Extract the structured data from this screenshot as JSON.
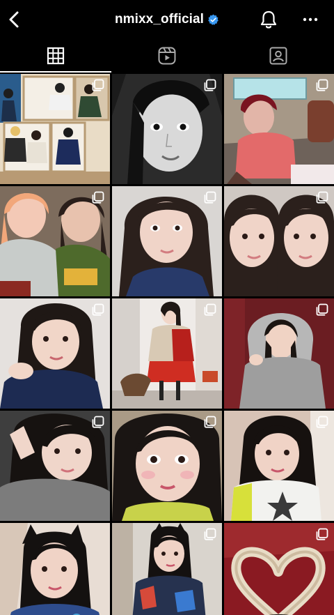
{
  "header": {
    "username": "nmixx_official",
    "back_icon": "chevron-left-icon",
    "verified_icon": "verified-badge-icon",
    "verified_color": "#3897f0",
    "bell_icon": "bell-icon",
    "more_icon": "more-horizontal-icon"
  },
  "tabs": [
    {
      "icon": "grid-icon",
      "active": true
    },
    {
      "icon": "reels-icon",
      "active": false
    },
    {
      "icon": "tagged-icon",
      "active": false
    }
  ],
  "posts": [
    {
      "kind": "group-photo",
      "carousel": true
    },
    {
      "kind": "bw-portrait",
      "carousel": true
    },
    {
      "kind": "red-hair-portrait",
      "carousel": true
    },
    {
      "kind": "two-girls-scarves",
      "carousel": true
    },
    {
      "kind": "selfie-bangs",
      "carousel": true
    },
    {
      "kind": "selfie-double",
      "carousel": true
    },
    {
      "kind": "selfie-navy-jacket",
      "carousel": true
    },
    {
      "kind": "mirror-room-outfit",
      "carousel": true
    },
    {
      "kind": "grey-hoodie",
      "carousel": true
    },
    {
      "kind": "peace-sign-selfie",
      "carousel": true
    },
    {
      "kind": "closeup-makeup",
      "carousel": true
    },
    {
      "kind": "star-sweater",
      "carousel": true
    },
    {
      "kind": "cat-ear-hair",
      "carousel": false
    },
    {
      "kind": "cat-ear-hair-jacket",
      "carousel": true
    },
    {
      "kind": "heart-hair",
      "carousel": true
    }
  ],
  "colors": {
    "background": "#000000",
    "text": "#ffffff"
  }
}
